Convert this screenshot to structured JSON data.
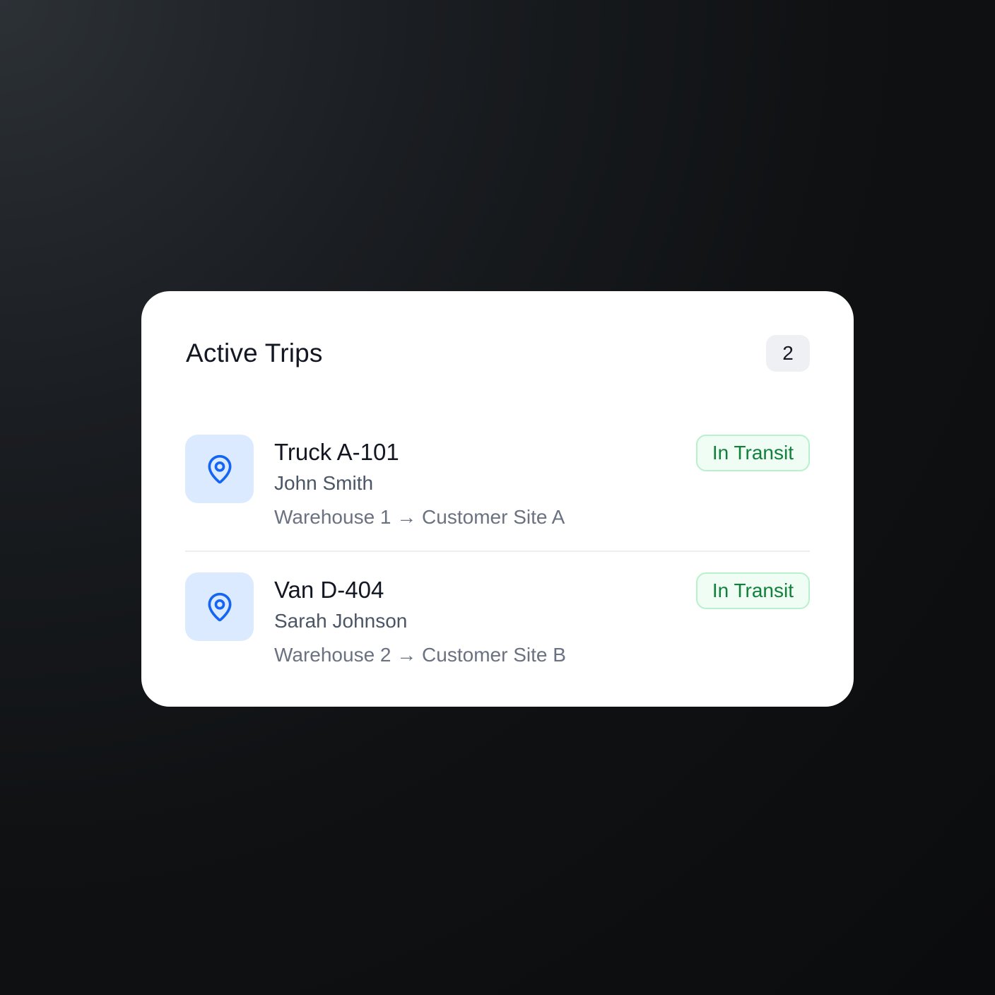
{
  "card": {
    "title": "Active Trips",
    "count": "2"
  },
  "trips": [
    {
      "vehicle": "Truck A-101",
      "driver": "John Smith",
      "route": "Warehouse 1 → Customer Site A",
      "status": "In Transit",
      "icon": "map-pin-icon"
    },
    {
      "vehicle": "Van D-404",
      "driver": "Sarah Johnson",
      "route": "Warehouse 2 → Customer Site B",
      "status": "In Transit",
      "icon": "map-pin-icon"
    }
  ],
  "colors": {
    "accent": "#1565f5",
    "icon_bg": "#dbeafe",
    "status_text": "#12803b",
    "status_bg": "#effdf4",
    "status_border": "#b8f1cc"
  }
}
